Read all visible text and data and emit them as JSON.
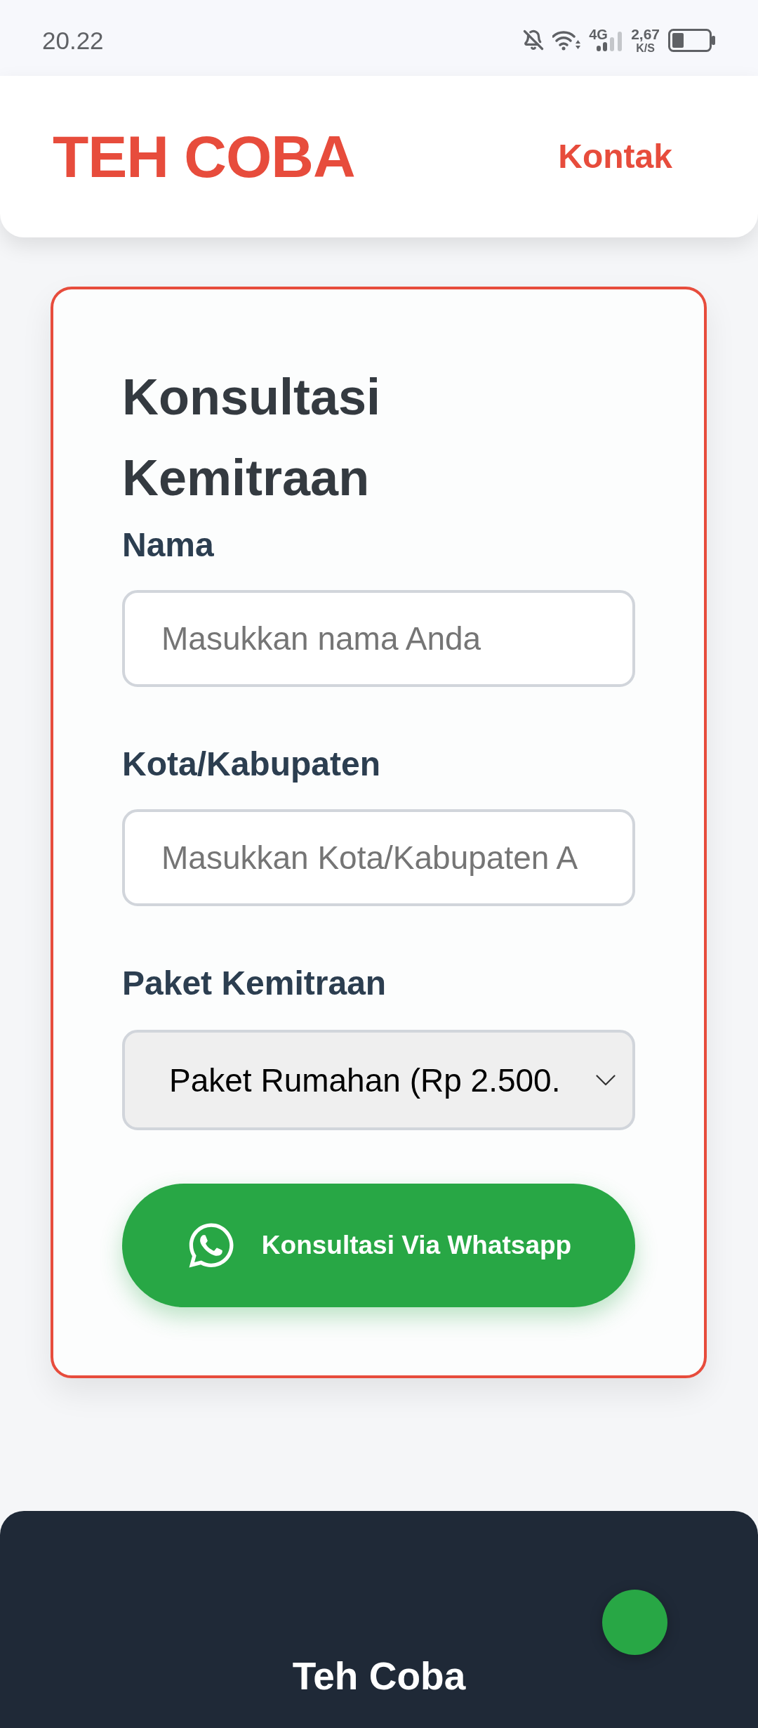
{
  "status_bar": {
    "time": "20.22",
    "network_type": "4G",
    "speed_value": "2,67",
    "speed_unit": "K/S"
  },
  "header": {
    "brand": "TEH COBA",
    "nav_link": "Kontak"
  },
  "form": {
    "title": "Konsultasi Kemitraan",
    "fields": [
      {
        "kind": "input",
        "label": "Nama",
        "placeholder": "Masukkan nama Anda"
      },
      {
        "kind": "input",
        "label": "Kota/Kabupaten",
        "placeholder": "Masukkan Kota/Kabupaten A"
      },
      {
        "kind": "select",
        "label": "Paket Kemitraan",
        "value": "Paket Rumahan (Rp 2.500."
      }
    ],
    "submit": {
      "label": "Konsultasi Via Whatsapp"
    }
  },
  "footer": {
    "brand": "Teh Coba"
  }
}
